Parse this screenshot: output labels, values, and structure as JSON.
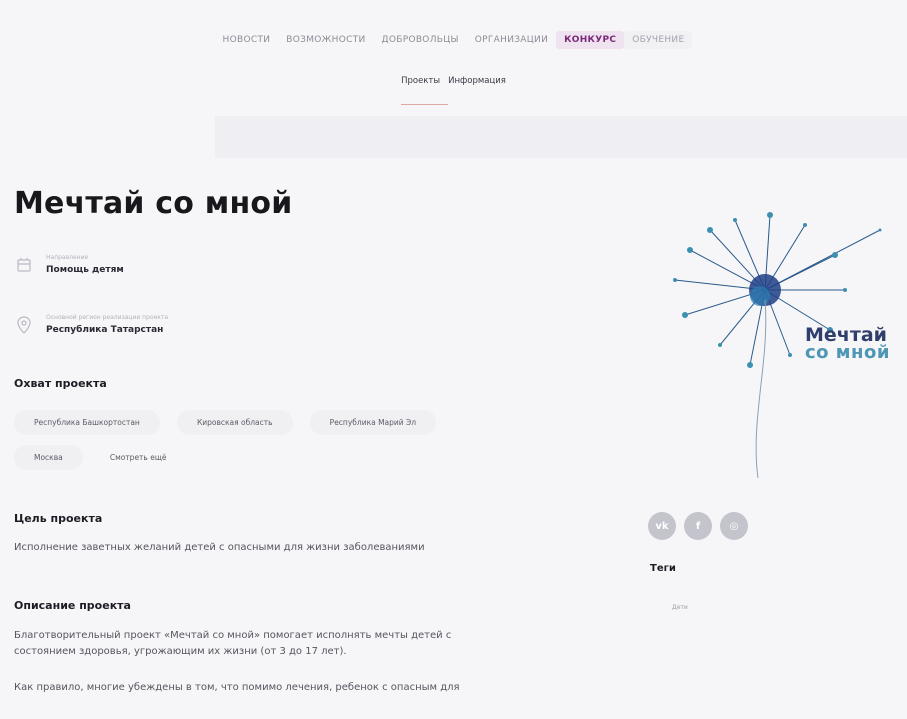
{
  "nav": {
    "items": [
      {
        "label": "НОВОСТИ",
        "state": "normal"
      },
      {
        "label": "ВОЗМОЖНОСТИ",
        "state": "normal"
      },
      {
        "label": "ДОБРОВОЛЬЦЫ",
        "state": "normal"
      },
      {
        "label": "ОРГАНИЗАЦИИ",
        "state": "normal"
      },
      {
        "label": "КОНКУРС",
        "state": "active"
      },
      {
        "label": "ОБУЧЕНИЕ",
        "state": "muted"
      }
    ]
  },
  "subnav": {
    "tabs": [
      {
        "label": "Проекты",
        "active": true
      },
      {
        "label": "Информация",
        "active": false
      }
    ]
  },
  "project": {
    "title": "Мечтай со мной",
    "category_label": "Направление",
    "category_value": "Помощь детям",
    "region_label": "Основной регион реализации проекта",
    "region_value": "Республика Татарстан"
  },
  "coverage": {
    "heading": "Охват проекта",
    "regions": [
      "Республика Башкортостан",
      "Кировская область",
      "Республика Марий Эл",
      "Москва"
    ],
    "show_more": "Смотреть ещё"
  },
  "goal": {
    "heading": "Цель проекта",
    "text": "Исполнение заветных желаний детей с опасными для жизни заболеваниями"
  },
  "description": {
    "heading": "Описание проекта",
    "p1_line1": "Благотворительный проект «Мечтай со мной» помогает исполнять мечты детей с",
    "p1_line2": "состоянием здоровья, угрожающим их жизни (от 3 до 17 лет).",
    "p2": "Как правило, многие убеждены в том, что помимо лечения, ребенок с опасным для"
  },
  "logo": {
    "line1": "Мечтай",
    "line2": "со мной"
  },
  "social": {
    "vk": "vk",
    "fb": "f",
    "ig": "◎"
  },
  "tags": {
    "heading": "Теги",
    "items": [
      "Дети"
    ]
  },
  "colors": {
    "accent": "#7a2a7a",
    "logo_dark": "#2f3e6b",
    "logo_light": "#4d96b4"
  }
}
